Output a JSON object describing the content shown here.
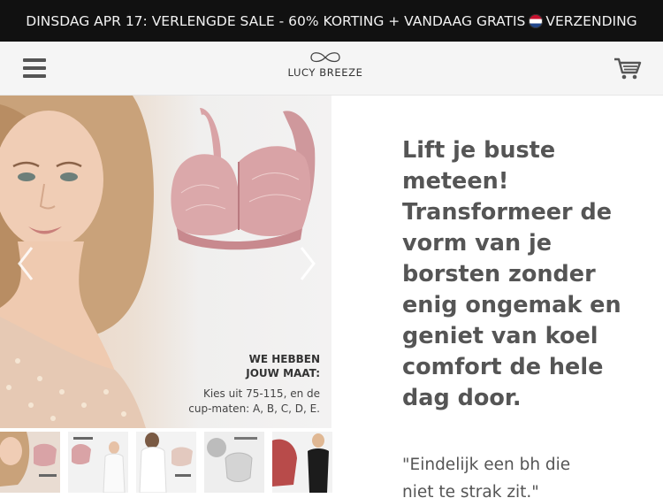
{
  "announcement": {
    "text_before": "DINSDAG APR 17: VERLENGDE SALE - 60% KORTING + VANDAAG GRATIS",
    "text_after": "VERZENDING",
    "flag_icon": "netherlands-flag-icon"
  },
  "header": {
    "brand": "LUCY BREEZE",
    "menu_icon": "hamburger-menu-icon",
    "cart_icon": "shopping-cart-icon"
  },
  "gallery": {
    "size_title_line1": "WE HEBBEN",
    "size_title_line2": "JOUW MAAT:",
    "size_desc_line1": "Kies uit 75-115, en de",
    "size_desc_line2": "cup-maten: A, B, C, D, E.",
    "thumbnail_count": 5
  },
  "content": {
    "headline": "Lift je buste meteen! Transformeer de vorm van je borsten zonder enig ongemak en geniet van koel comfort de hele dag door.",
    "quote_line1": "\"Eindelijk een bh die",
    "quote_line2": "niet te strak zit.\""
  },
  "colors": {
    "announcement_bg": "#111111",
    "header_bg": "#f5f5f5",
    "bra_pink": "#d9a3a6",
    "text_gray": "#555555"
  }
}
